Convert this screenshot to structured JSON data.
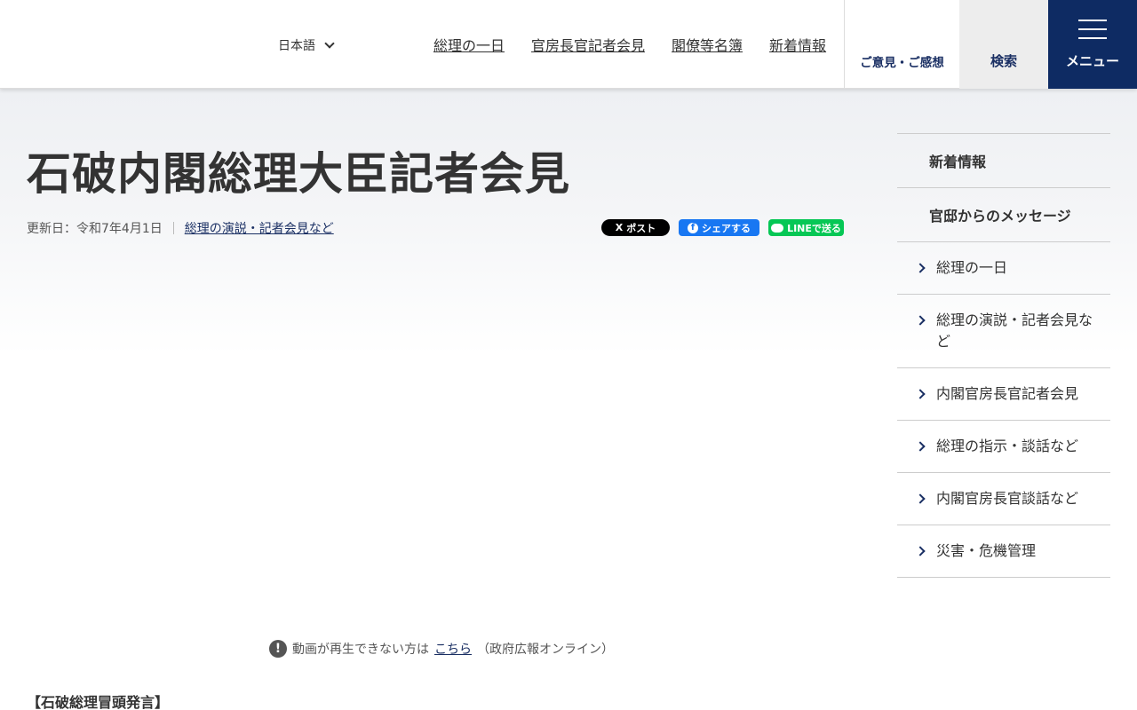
{
  "header": {
    "language": "日本語",
    "nav": [
      "総理の一日",
      "官房長官記者会見",
      "閣僚等名簿",
      "新着情報"
    ],
    "opinion_label": "ご意見・ご感想",
    "search_label": "検索",
    "menu_label": "メニュー"
  },
  "page": {
    "title": "石破内閣総理大臣記者会見",
    "updated": "更新日：令和7年4月1日",
    "category_link": "総理の演説・記者会見など"
  },
  "share": {
    "x_label": "ポスト",
    "x_icon": "X",
    "fb_label": "シェアする",
    "fb_icon": "f",
    "line_label": "LINEで送る"
  },
  "video_notice": {
    "prefix": "動画が再生できない方は",
    "link": "こちら",
    "suffix": "（政府広報オンライン）"
  },
  "section_heading": "【石破総理冒頭発言】",
  "sidebar": {
    "top_items": [
      "新着情報",
      "官邸からのメッセージ"
    ],
    "sub_items": [
      "総理の一日",
      "総理の演説・記者会見など",
      "内閣官房長官記者会見",
      "総理の指示・談話など",
      "内閣官房長官談話など",
      "災害・危機管理"
    ]
  },
  "colors": {
    "brand_navy": "#0e2b63",
    "link_navy": "#1a2f63",
    "facebook": "#1877f2",
    "line": "#06c755"
  }
}
